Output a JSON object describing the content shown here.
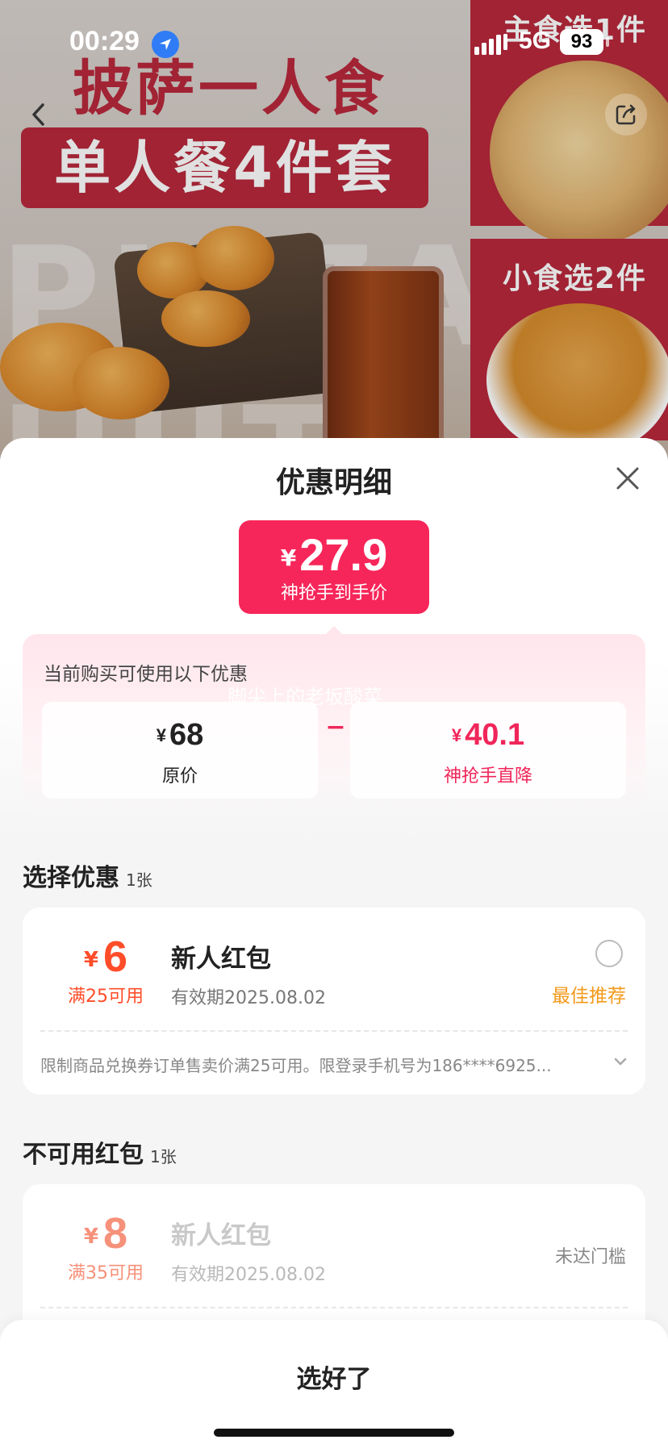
{
  "status_bar": {
    "time": "00:29",
    "network": "5G",
    "battery": "93"
  },
  "hero": {
    "headline_1": "披萨一人食",
    "headline_2": "单人餐4件套",
    "side_label_1": "主食选1件",
    "side_label_2": "小食选2件",
    "ghost_text": "PIZZA HUT"
  },
  "sheet": {
    "title": "优惠明细",
    "final_price": {
      "currency": "¥",
      "amount": "27.9",
      "label": "神抢手到手价"
    },
    "promo_caption": "当前购买可使用以下优惠",
    "watermark": "脚尖上的老坂酸菜",
    "original": {
      "currency": "¥",
      "amount": "68",
      "label": "原价"
    },
    "minus": "−",
    "discount": {
      "currency": "¥",
      "amount": "40.1",
      "label": "神抢手直降"
    }
  },
  "available_section": {
    "title": "选择优惠",
    "count": "1张"
  },
  "available_coupon": {
    "currency": "¥",
    "amount": "6",
    "threshold": "满25可用",
    "name": "新人红包",
    "expiry": "有效期2025.08.02",
    "tag": "最佳推荐",
    "description": "限制商品兑换券订单售卖价满25可用。限登录手机号为186****6925..."
  },
  "unavailable_section": {
    "title": "不可用红包",
    "count": "1张"
  },
  "unavailable_coupon": {
    "currency": "¥",
    "amount": "8",
    "threshold": "满35可用",
    "name": "新人红包",
    "expiry": "有效期2025.08.02",
    "status": "未达门槛"
  },
  "bottom_bar": {
    "confirm_label": "选好了"
  },
  "colors": {
    "accent_red": "#f7265a",
    "coupon_orange": "#ff4d2a",
    "recommend_orange": "#f39a1b",
    "brand_red": "#b8283c"
  },
  "icons": {
    "location": "location-arrow-icon",
    "back": "chevron-left-icon",
    "share": "share-icon",
    "close": "close-icon",
    "expand": "chevron-down-icon"
  }
}
